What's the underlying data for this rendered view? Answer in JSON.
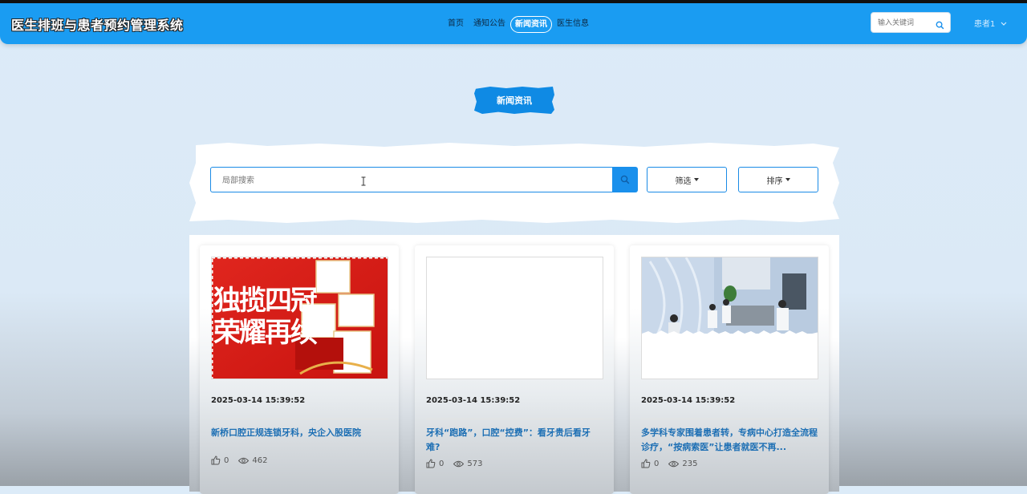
{
  "header": {
    "brand": "医生排班与患者预约管理系统",
    "nav": [
      {
        "label": "首页",
        "active": false
      },
      {
        "label": "通知公告",
        "active": false
      },
      {
        "label": "新闻资讯",
        "active": true
      },
      {
        "label": "医生信息",
        "active": false
      }
    ],
    "search_placeholder": "输入关键词",
    "user": "患者1"
  },
  "section": {
    "title": "新闻资讯"
  },
  "filters": {
    "search_placeholder": "局部搜索",
    "filter_label": "筛选",
    "sort_label": "排序"
  },
  "news": [
    {
      "date": "2025-03-14 15:39:52",
      "title": "新桥口腔正规连锁牙科，央企入股医院",
      "likes": "0",
      "views": "462",
      "image_text": [
        "独揽四冠",
        "荣耀再续"
      ]
    },
    {
      "date": "2025-03-14 15:39:52",
      "title": "牙科“跑路”，口腔“控费”：看牙贵后看牙难?",
      "likes": "0",
      "views": "573"
    },
    {
      "date": "2025-03-14 15:39:52",
      "title": "多学科专家围着患者转，专病中心打造全流程诊疗，“按病索医”让患者就医不再...",
      "likes": "0",
      "views": "235"
    }
  ]
}
